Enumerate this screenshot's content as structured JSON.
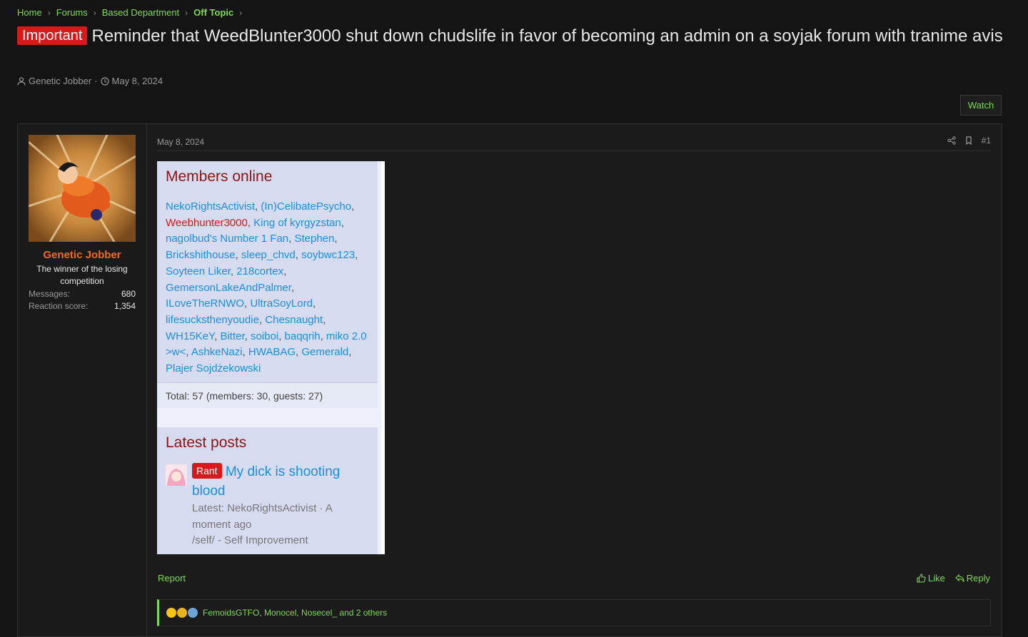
{
  "breadcrumb": {
    "items": [
      "Home",
      "Forums",
      "Based Department",
      "Off Topic"
    ]
  },
  "thread": {
    "prefix": "Important",
    "title": "Reminder that WeedBlunter3000 shut down chudslife in favor of becoming an admin on a soyjak forum with tranime avis",
    "author": "Genetic Jobber",
    "date": "May 8, 2024",
    "watch_label": "Watch"
  },
  "post": {
    "user": {
      "name": "Genetic Jobber",
      "title": "The winner of the losing competition",
      "messages_label": "Messages:",
      "messages_value": "680",
      "reaction_label": "Reaction score:",
      "reaction_value": "1,354"
    },
    "date": "May 8, 2024",
    "number": "#1",
    "report_label": "Report",
    "like_label": "Like",
    "reply_label": "Reply",
    "reactions_text": "FemoidsGTFO, Monocel, Nosecel_ and 2 others"
  },
  "embed": {
    "members_online_title": "Members online",
    "members": [
      {
        "name": "NekoRightsActivist",
        "red": false
      },
      {
        "name": "(In)CelibatePsycho",
        "red": false
      },
      {
        "name": "Weebhunter3000",
        "red": true
      },
      {
        "name": "King of kyrgyzstan",
        "red": false
      },
      {
        "name": "nagolbud's Number 1 Fan",
        "red": false
      },
      {
        "name": "Stephen",
        "red": false
      },
      {
        "name": "Brickshithouse",
        "red": false
      },
      {
        "name": "sleep_chvd",
        "red": false
      },
      {
        "name": "soybwc123",
        "red": false
      },
      {
        "name": "Soyteen Liker",
        "red": false
      },
      {
        "name": "218cortex",
        "red": false
      },
      {
        "name": "GemersonLakeAndPalmer",
        "red": false
      },
      {
        "name": "ILoveTheRNWO",
        "red": false
      },
      {
        "name": "UltraSoyLord",
        "red": false
      },
      {
        "name": "lifesucksthenyoudie",
        "red": false
      },
      {
        "name": "Chesnaught",
        "red": false
      },
      {
        "name": "WH15KeY",
        "red": false
      },
      {
        "name": "Bitter",
        "red": false
      },
      {
        "name": "soiboi",
        "red": false
      },
      {
        "name": "baqqrih",
        "red": false
      },
      {
        "name": "miko 2.0 >w<",
        "red": false
      },
      {
        "name": "AshkeNazi",
        "red": false
      },
      {
        "name": "HWABAG",
        "red": false
      },
      {
        "name": "Gemerald",
        "red": false
      },
      {
        "name": "Plajer Sojdżekowski",
        "red": false
      }
    ],
    "totals": "Total: 57 (members: 30, guests: 27)",
    "latest_posts_title": "Latest posts",
    "latest": {
      "prefix": "Rant",
      "title": "My dick is shooting blood",
      "meta_line1": "Latest: NekoRightsActivist · A moment ago",
      "meta_line2": "/self/ - Self Improvement"
    }
  },
  "colors": {
    "accent": "#7ed957",
    "username": "#f06a25",
    "important": "#d61a1a"
  },
  "icons": [
    "user-icon",
    "clock-icon",
    "share-icon",
    "bookmark-icon",
    "like-icon",
    "reply-icon",
    "chevron-right-icon"
  ]
}
